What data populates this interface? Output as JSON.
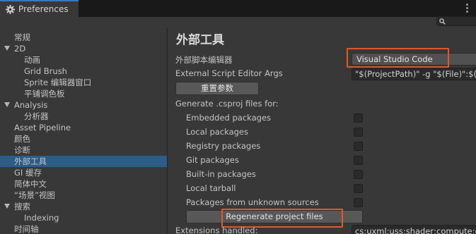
{
  "window": {
    "tab_title": "Preferences",
    "tab_icon": "gear-icon"
  },
  "search": {
    "placeholder": ""
  },
  "sidebar": {
    "items": [
      {
        "label": "常规",
        "indent": 1,
        "expandable": false,
        "selected": false
      },
      {
        "label": "2D",
        "indent": 1,
        "expandable": true,
        "selected": false
      },
      {
        "label": "动画",
        "indent": 2,
        "expandable": false,
        "selected": false
      },
      {
        "label": "Grid Brush",
        "indent": 2,
        "expandable": false,
        "selected": false
      },
      {
        "label": "Sprite 编辑器窗口",
        "indent": 2,
        "expandable": false,
        "selected": false
      },
      {
        "label": "平铺调色板",
        "indent": 2,
        "expandable": false,
        "selected": false
      },
      {
        "label": "Analysis",
        "indent": 1,
        "expandable": true,
        "selected": false
      },
      {
        "label": "分析器",
        "indent": 2,
        "expandable": false,
        "selected": false
      },
      {
        "label": "Asset Pipeline",
        "indent": 1,
        "expandable": false,
        "selected": false
      },
      {
        "label": "颜色",
        "indent": 1,
        "expandable": false,
        "selected": false
      },
      {
        "label": "诊断",
        "indent": 1,
        "expandable": false,
        "selected": false
      },
      {
        "label": "外部工具",
        "indent": 1,
        "expandable": false,
        "selected": true
      },
      {
        "label": "GI 缓存",
        "indent": 1,
        "expandable": false,
        "selected": false
      },
      {
        "label": "简体中文",
        "indent": 1,
        "expandable": false,
        "selected": false
      },
      {
        "label": "“场景”视图",
        "indent": 1,
        "expandable": false,
        "selected": false
      },
      {
        "label": "搜索",
        "indent": 1,
        "expandable": true,
        "selected": false
      },
      {
        "label": "Indexing",
        "indent": 2,
        "expandable": false,
        "selected": false
      },
      {
        "label": "时间轴",
        "indent": 1,
        "expandable": false,
        "selected": false
      }
    ]
  },
  "main": {
    "title": "外部工具",
    "external_script_editor_label": "外部脚本编辑器",
    "external_script_editor_value": "Visual Studio Code",
    "external_script_editor_args_label": "External Script Editor Args",
    "external_script_editor_args_value": "\"$(ProjectPath)\" -g \"$(File)\":$(Line):$(Column)",
    "reset_args_button": "重置参数",
    "generate_csproj_label": "Generate .csproj files for:",
    "packages": [
      {
        "label": "Embedded packages",
        "checked": false
      },
      {
        "label": "Local packages",
        "checked": false
      },
      {
        "label": "Registry packages",
        "checked": false
      },
      {
        "label": "Git packages",
        "checked": false
      },
      {
        "label": "Built-in packages",
        "checked": false
      },
      {
        "label": "Local tarball",
        "checked": false
      },
      {
        "label": "Packages from unknown sources",
        "checked": false
      }
    ],
    "regenerate_button": "Regenerate project files",
    "extensions_handled_label": "Extensions handled:",
    "extensions_handled_value": "cs;uxml;uss;shader;compute;cginc;hlsl;glslinc;template;raytrace"
  },
  "colors": {
    "background": "#383838",
    "selection": "#2c5d87",
    "highlight_annotation": "#e2572a",
    "tab_accent": "#3a79bb"
  }
}
